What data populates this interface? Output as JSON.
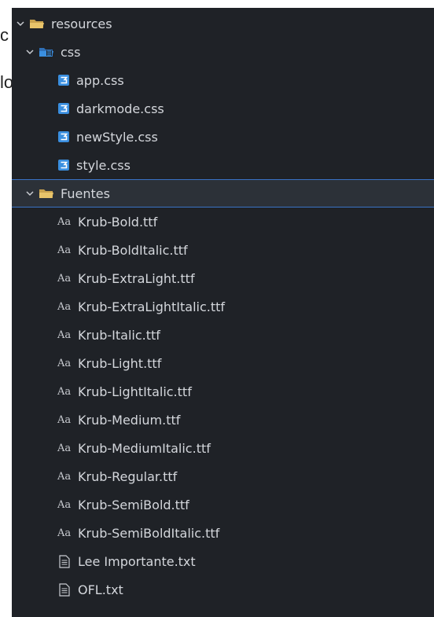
{
  "background_text": [
    "c",
    "lo"
  ],
  "tree": {
    "root_folder": "resources",
    "css_folder": {
      "label": "css",
      "files": [
        "app.css",
        "darkmode.css",
        "newStyle.css",
        "style.css"
      ]
    },
    "fuentes_folder": {
      "label": "Fuentes",
      "font_files": [
        "Krub-Bold.ttf",
        "Krub-BoldItalic.ttf",
        "Krub-ExtraLight.ttf",
        "Krub-ExtraLightItalic.ttf",
        "Krub-Italic.ttf",
        "Krub-Light.ttf",
        "Krub-LightItalic.ttf",
        "Krub-Medium.ttf",
        "Krub-MediumItalic.ttf",
        "Krub-Regular.ttf",
        "Krub-SemiBold.ttf",
        "Krub-SemiBoldItalic.ttf"
      ],
      "font_icon_text": "Aa",
      "text_files": [
        "Lee Importante.txt",
        "OFL.txt"
      ]
    }
  },
  "colors": {
    "panel_bg": "#1f2227",
    "selection_border": "#3a73c6",
    "css_icon": "#3a8fe0",
    "folder_icon": "#e8c46a"
  }
}
